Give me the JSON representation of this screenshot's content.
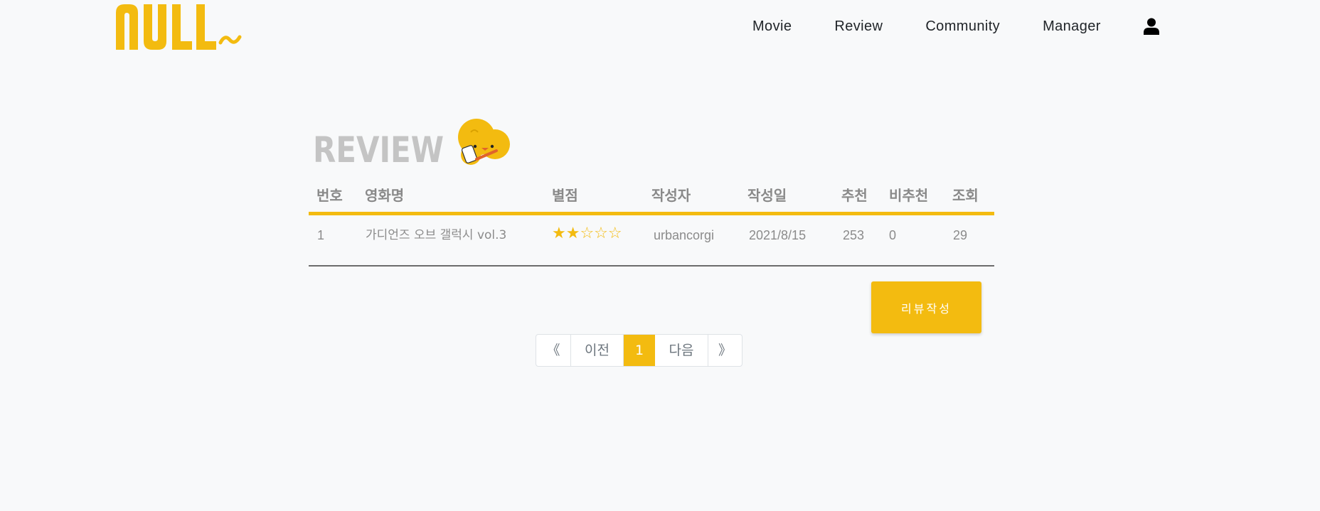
{
  "header": {
    "logo_text": "NULL~",
    "nav": [
      "Movie",
      "Review",
      "Community",
      "Manager"
    ],
    "user_icon": "user-icon"
  },
  "page": {
    "title_text": "REVIEW",
    "mascot_icon": "yellow-chick-writing-icon"
  },
  "table": {
    "columns": [
      "번호",
      "영화명",
      "별점",
      "작성자",
      "작성일",
      "추천",
      "비추천",
      "조회"
    ],
    "rows": [
      {
        "no": "1",
        "movie": "가디언즈 오브 갤럭시 vol.3",
        "stars": "★★☆☆☆",
        "rating": 2,
        "rating_max": 5,
        "author": "urbancorgi",
        "date": "2021/8/15",
        "likes": "253",
        "dislikes": "0",
        "views": "29"
      }
    ]
  },
  "write_button": "리뷰작성",
  "pagination": {
    "first": "《",
    "prev": "이전",
    "current": "1",
    "next": "다음",
    "last": "》"
  },
  "colors": {
    "accent": "#f3bb10",
    "background": "#f8f9fa",
    "title_gray": "#c4c4c4",
    "text_gray": "#8b8b8b"
  }
}
